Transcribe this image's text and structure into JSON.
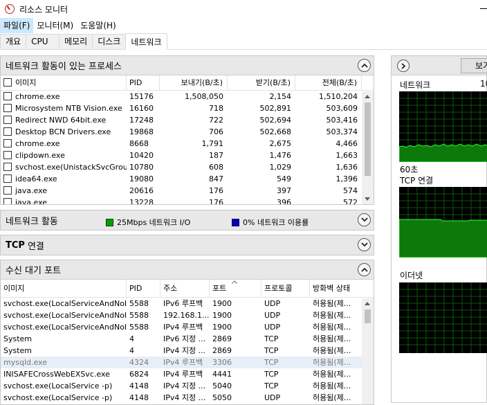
{
  "window": {
    "title": "리소스 모니터"
  },
  "menu": [
    "파일(F)",
    "모니터(M)",
    "도움말(H)"
  ],
  "tabs": [
    "개요",
    "CPU",
    "메모리",
    "디스크",
    "네트워크"
  ],
  "processes": {
    "title": "네트워크 활동이 있는 프로세스",
    "columns": [
      "이미지",
      "PID",
      "보내기(B/초)",
      "받기(B/초)",
      "전체(B/초)"
    ],
    "rows": [
      [
        "chrome.exe",
        "15176",
        "1,508,050",
        "2,154",
        "1,510,204"
      ],
      [
        "Microsystem NTB Vision.exe",
        "16160",
        "718",
        "502,891",
        "503,609"
      ],
      [
        "Redirect NWD 64bit.exe",
        "17248",
        "722",
        "502,694",
        "503,416"
      ],
      [
        "Desktop BCN Drivers.exe",
        "19868",
        "706",
        "502,668",
        "503,374"
      ],
      [
        "chrome.exe",
        "8668",
        "1,791",
        "2,675",
        "4,466"
      ],
      [
        "clipdown.exe",
        "10420",
        "187",
        "1,476",
        "1,663"
      ],
      [
        "svchost.exe(UnistackSvcGroup)",
        "10780",
        "608",
        "1,029",
        "1,636"
      ],
      [
        "idea64.exe",
        "19080",
        "847",
        "549",
        "1,396"
      ],
      [
        "java.exe",
        "20616",
        "176",
        "397",
        "574"
      ],
      [
        "java.exe",
        "13228",
        "176",
        "396",
        "572"
      ]
    ]
  },
  "network_activity": {
    "title": "네트워크 활동",
    "io_label": "25Mbps 네트워크 I/O",
    "usage_label": "0% 네트워크 이용률",
    "io_color": "#00a000",
    "usage_color": "#0000c0"
  },
  "tcp": {
    "title_bold": "TCP",
    "title_rest": "연결"
  },
  "listening": {
    "title": "수신 대기 포트",
    "columns": [
      "이미지",
      "PID",
      "주소",
      "포트",
      "프로토콜",
      "방화벽 상태"
    ],
    "rows": [
      [
        "svchost.exe(LocalServiceAndNoI...",
        "5588",
        "IPv6 루프백",
        "1900",
        "UDP",
        "허용됨(제..."
      ],
      [
        "svchost.exe(LocalServiceAndNoI...",
        "5588",
        "192.168.1....",
        "1900",
        "UDP",
        "허용됨(제..."
      ],
      [
        "svchost.exe(LocalServiceAndNoI...",
        "5588",
        "IPv4 루프백",
        "1900",
        "UDP",
        "허용됨(제..."
      ],
      [
        "System",
        "4",
        "IPv6 지정 ...",
        "2869",
        "TCP",
        "허용됨(제..."
      ],
      [
        "System",
        "4",
        "IPv4 지정 ...",
        "2869",
        "TCP",
        "허용됨(제..."
      ],
      [
        "mysqld.exe",
        "4324",
        "IPv4 루프백",
        "3306",
        "TCP",
        "허용됨(제..."
      ],
      [
        "INISAFECrossWebEXSvc.exe",
        "6824",
        "IPv4 루프백",
        "4441",
        "TCP",
        "허용됨(제..."
      ],
      [
        "svchost.exe(LocalService -p)",
        "4148",
        "IPv4 지정 ...",
        "5040",
        "TCP",
        "허용됨(제..."
      ],
      [
        "svchost.exe(LocalService -p)",
        "4148",
        "IPv4 지정 ...",
        "5050",
        "UDP",
        "허용됨(제..."
      ]
    ]
  },
  "right_panel": {
    "view_button": "보기",
    "graph1_label": "네트워크",
    "graph1_value": "10",
    "graph1_footer": "60초",
    "graph2_label": "TCP 연결",
    "graph3_label": "이더넷",
    "graph_color": "#00ff00"
  }
}
